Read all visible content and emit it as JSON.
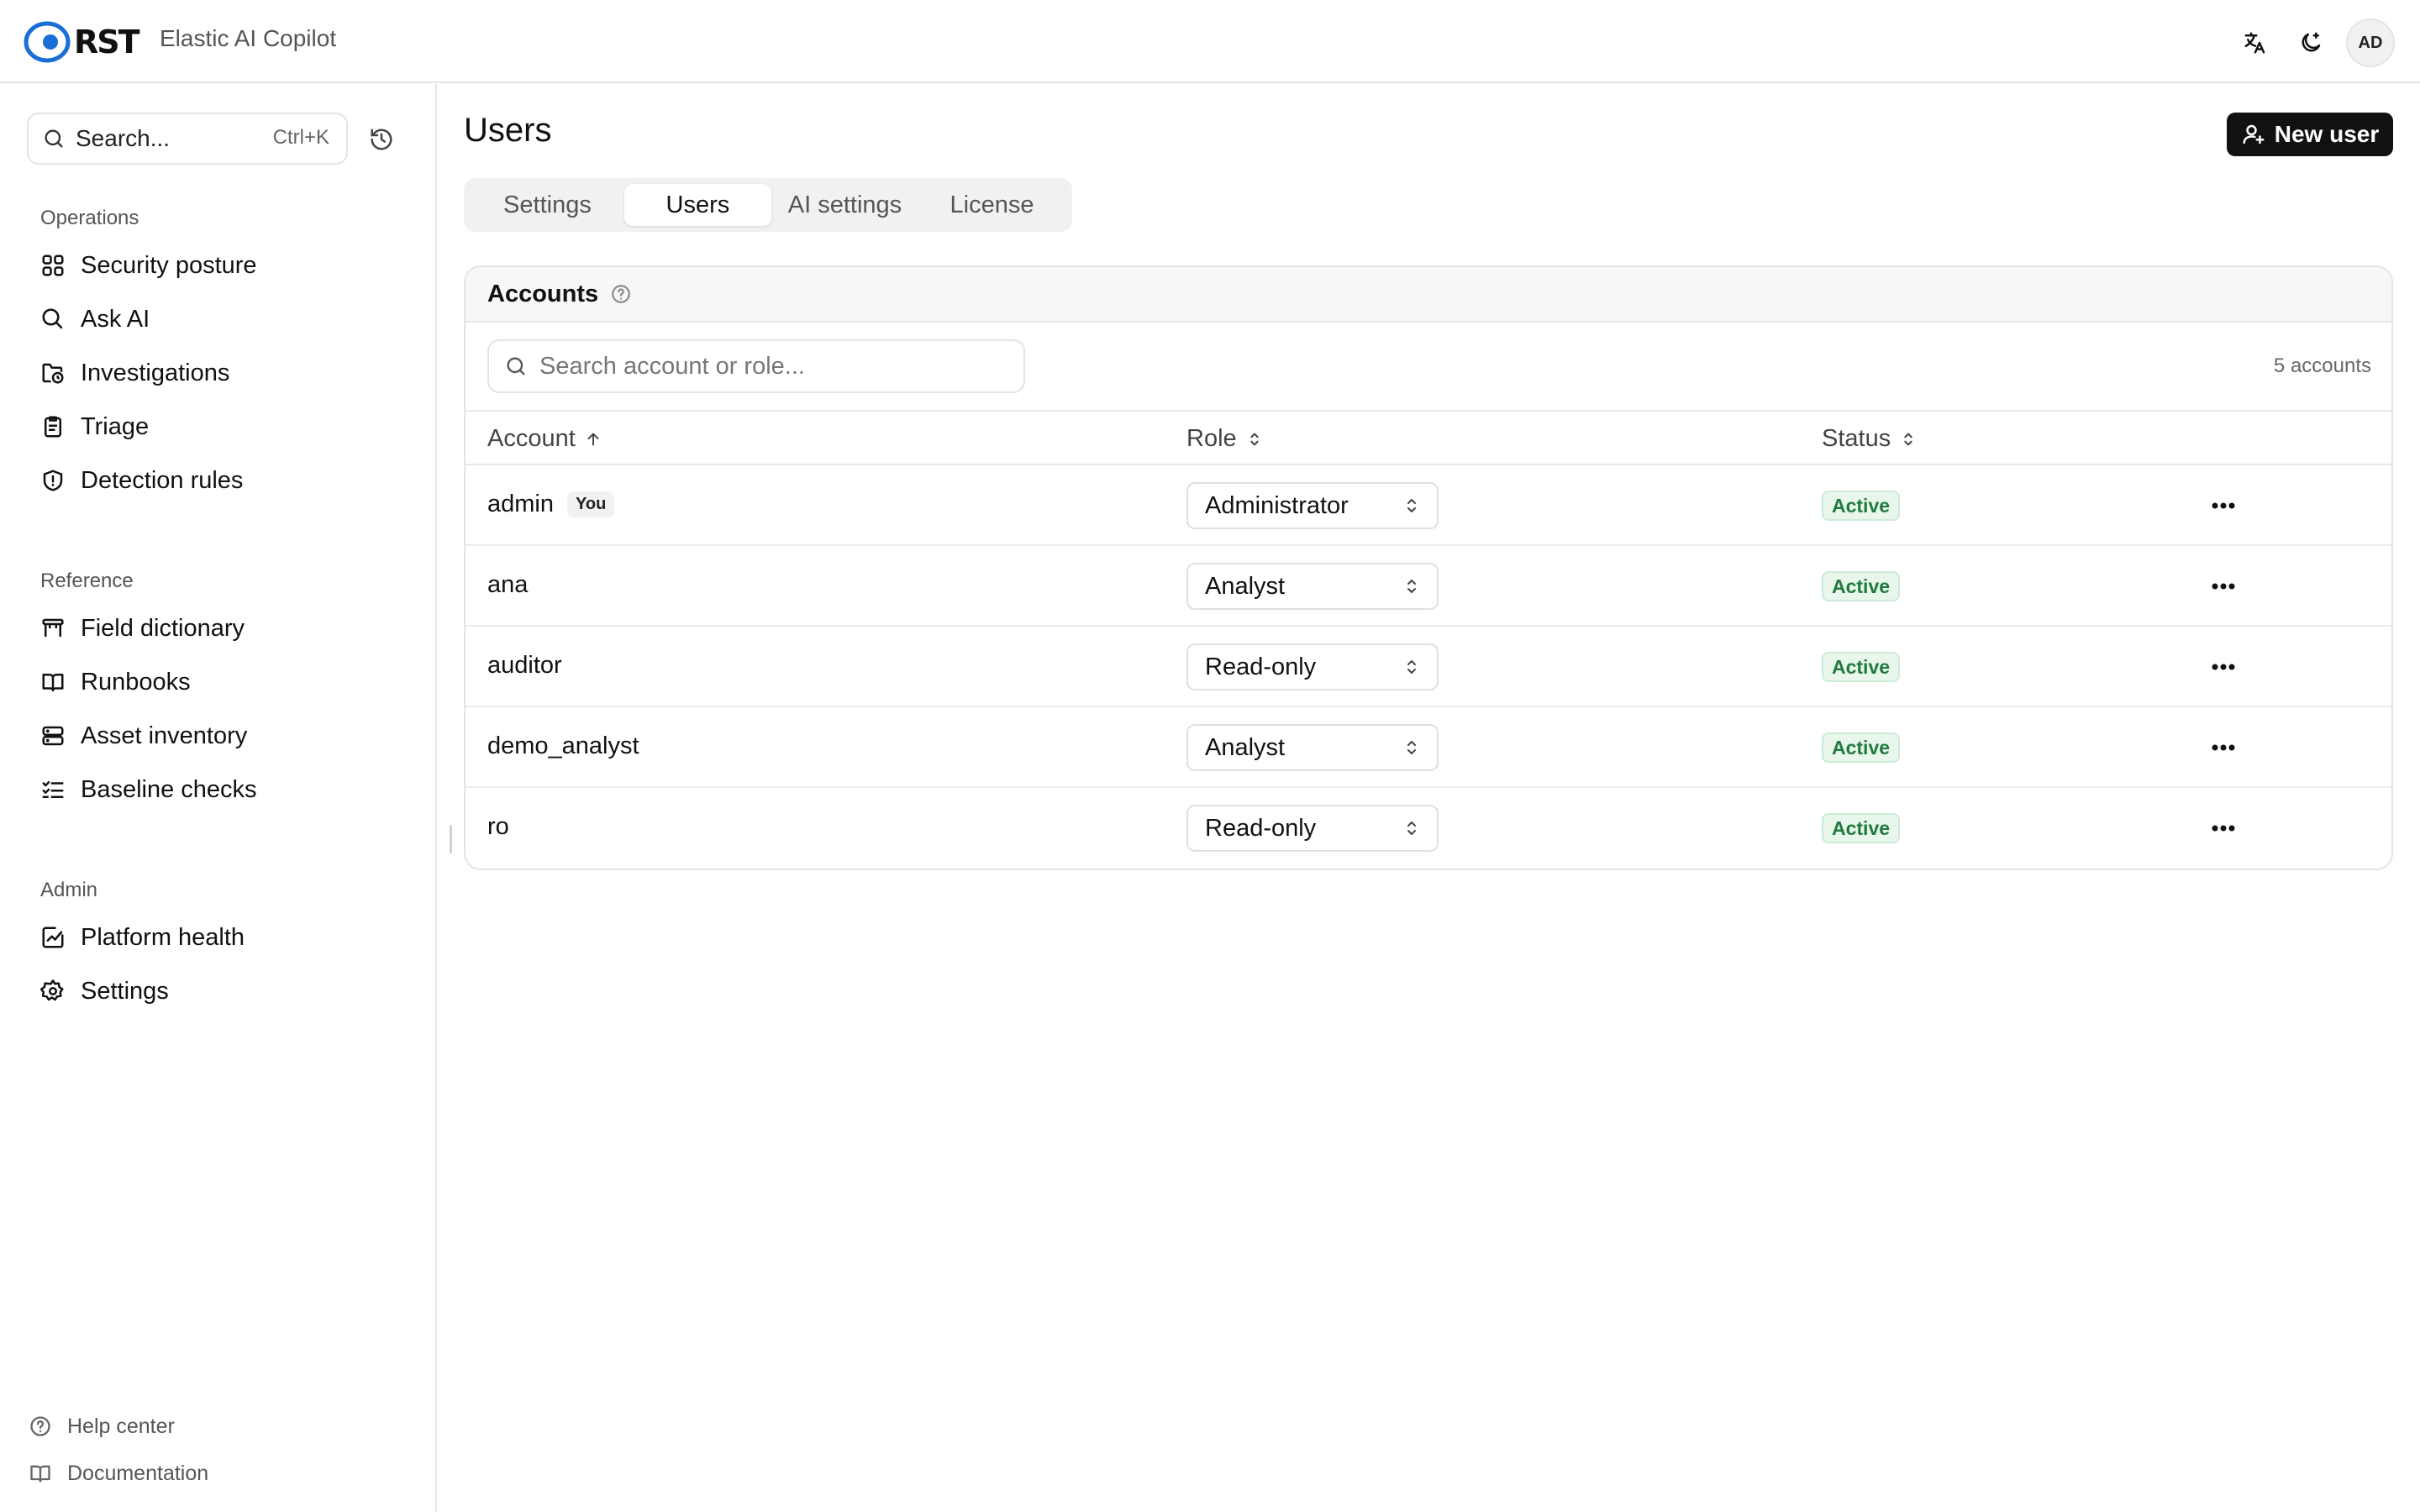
{
  "header": {
    "logo_text": "RST",
    "product_name": "Elastic AI Copilot",
    "avatar_initials": "AD"
  },
  "sidebar": {
    "search_placeholder": "Search...",
    "search_shortcut": "Ctrl+K",
    "sections": [
      {
        "heading": "Operations",
        "items": [
          {
            "label": "Security posture",
            "icon": "grid-icon"
          },
          {
            "label": "Ask AI",
            "icon": "search-icon"
          },
          {
            "label": "Investigations",
            "icon": "folder-clock-icon"
          },
          {
            "label": "Triage",
            "icon": "clipboard-icon"
          },
          {
            "label": "Detection rules",
            "icon": "shield-alert-icon"
          }
        ]
      },
      {
        "heading": "Reference",
        "items": [
          {
            "label": "Field dictionary",
            "icon": "table-icon"
          },
          {
            "label": "Runbooks",
            "icon": "book-icon"
          },
          {
            "label": "Asset inventory",
            "icon": "server-icon"
          },
          {
            "label": "Baseline checks",
            "icon": "checklist-icon"
          }
        ]
      },
      {
        "heading": "Admin",
        "items": [
          {
            "label": "Platform health",
            "icon": "chart-icon"
          },
          {
            "label": "Settings",
            "icon": "gear-icon"
          }
        ]
      }
    ],
    "footer": [
      {
        "label": "Help center",
        "icon": "help-circle-icon"
      },
      {
        "label": "Documentation",
        "icon": "book-open-icon"
      }
    ]
  },
  "main": {
    "title": "Users",
    "new_user_label": "New user",
    "tabs": [
      {
        "label": "Settings",
        "active": false
      },
      {
        "label": "Users",
        "active": true
      },
      {
        "label": "AI settings",
        "active": false
      },
      {
        "label": "License",
        "active": false
      }
    ],
    "accounts": {
      "title": "Accounts",
      "search_placeholder": "Search account or role...",
      "count_label": "5 accounts",
      "columns": {
        "account": "Account",
        "role": "Role",
        "status": "Status"
      },
      "rows": [
        {
          "account": "admin",
          "badge": "You",
          "role": "Administrator",
          "status": "Active"
        },
        {
          "account": "ana",
          "badge": "",
          "role": "Analyst",
          "status": "Active"
        },
        {
          "account": "auditor",
          "badge": "",
          "role": "Read-only",
          "status": "Active"
        },
        {
          "account": "demo_analyst",
          "badge": "",
          "role": "Analyst",
          "status": "Active"
        },
        {
          "account": "ro",
          "badge": "",
          "role": "Read-only",
          "status": "Active"
        }
      ]
    }
  },
  "colors": {
    "accent_blue": "#1a6fd6",
    "status_green": "#1f7a3d",
    "primary_button": "#111111"
  }
}
